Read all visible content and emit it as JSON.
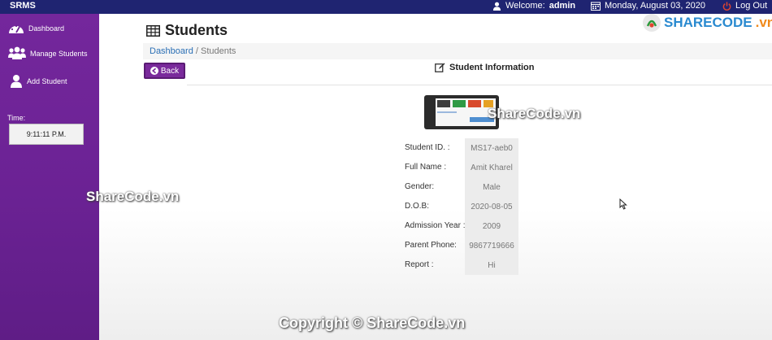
{
  "topbar": {
    "brand": "SRMS",
    "welcome_prefix": "Welcome:",
    "username": "admin",
    "date": "Monday, August 03, 2020",
    "logout_label": "Log Out"
  },
  "sidebar": {
    "items": [
      {
        "label": "Dashboard",
        "icon": "dashboard-icon"
      },
      {
        "label": "Manage Students",
        "icon": "users-icon"
      },
      {
        "label": "Add Student",
        "icon": "user-icon"
      }
    ],
    "time_label": "Time:",
    "time_value": "9:11:11 P.M."
  },
  "main": {
    "page_title": "Students",
    "breadcrumb": {
      "link": "Dashboard",
      "separator": "/",
      "current": "Students"
    },
    "back_label": "Back",
    "section_title": "Student Information",
    "student": [
      {
        "label": "Student ID. :",
        "value": "MS17-aeb0"
      },
      {
        "label": "Full Name :",
        "value": "Amit Kharel"
      },
      {
        "label": "Gender:",
        "value": "Male"
      },
      {
        "label": "D.O.B:",
        "value": "2020-08-05"
      },
      {
        "label": "Admission Year :",
        "value": "2009"
      },
      {
        "label": "Parent Phone:",
        "value": "9867719666"
      },
      {
        "label": "Report :",
        "value": "Hi"
      }
    ]
  },
  "watermarks": {
    "mid_right": "ShareCode.vn",
    "mid_left": "ShareCode.vn",
    "bottom": "Copyright © ShareCode.vn",
    "logo_main": "SHARECODE",
    "logo_suffix": ".vn"
  },
  "colors": {
    "topbar": "#1f2471",
    "sidebar": "#6b2294",
    "back_button": "#7a2a9c",
    "link": "#2a6fb5"
  }
}
